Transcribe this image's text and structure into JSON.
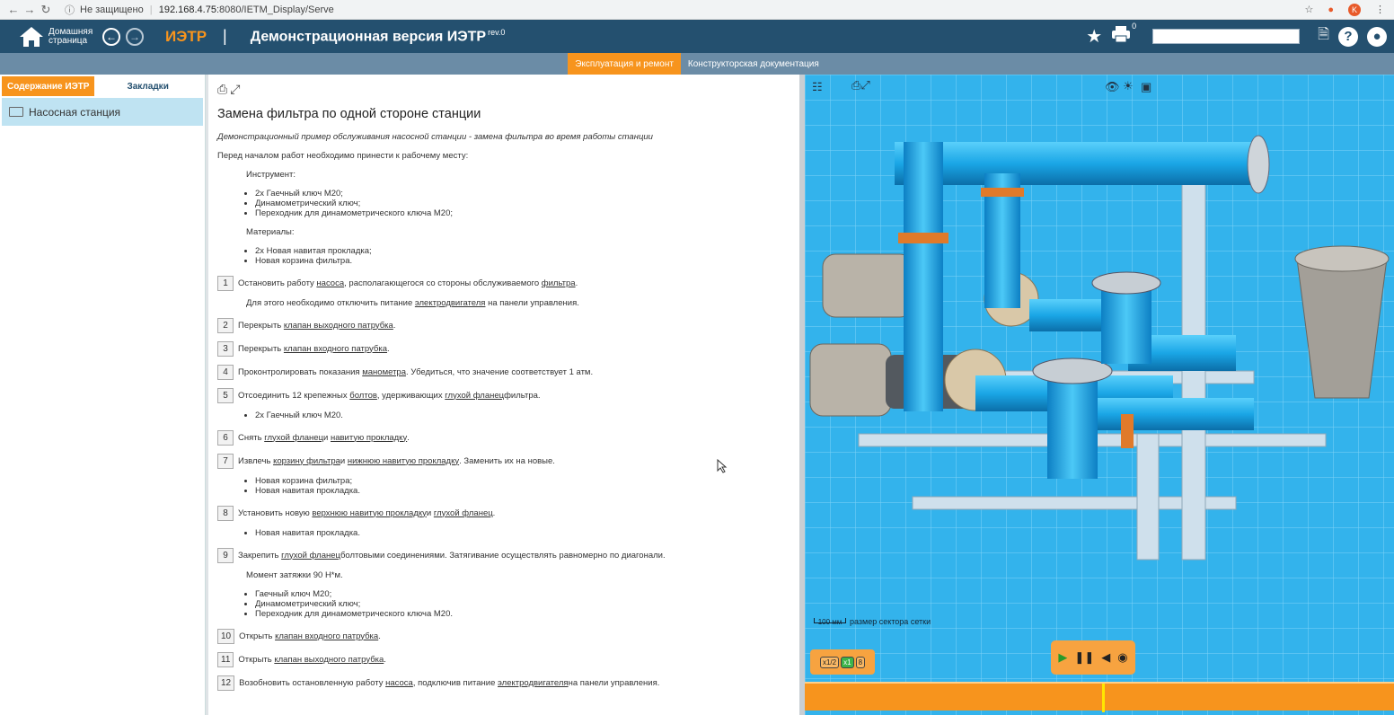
{
  "browser": {
    "security": "Не защищено",
    "host": "192.168.4.75",
    "path": ":8080/IETM_Display/Serve"
  },
  "appbar": {
    "home_label": "Домашняя страница",
    "brand": "ИЭТР",
    "title": "Демонстрационная версия ИЭТР",
    "rev": "rev.0",
    "print_badge": "0"
  },
  "subtabs": [
    "Эксплуатация и ремонт",
    "Конструкторская документация"
  ],
  "sidebar": {
    "tabs": [
      "Содержание ИЭТР",
      "Закладки"
    ],
    "tree": [
      "Насосная станция"
    ]
  },
  "doc": {
    "title": "Замена фильтра по одной стороне станции",
    "intro": "Демонстрационный пример обслуживания насосной станции - замена фильтра во время работы станции",
    "before": "Перед началом работ необходимо принести к рабочему месту:",
    "tools_hdr": "Инструмент:",
    "tools": [
      "2х Гаечный ключ М20;",
      "Динамометрический ключ;",
      "Переходник для динамометрического ключа М20;"
    ],
    "mat_hdr": "Материалы:",
    "materials": [
      "2х Новая навитая прокладка;",
      "Новая корзина фильтра."
    ],
    "s1": {
      "n": "1",
      "a": "Остановить работу ",
      "l1": "насоса",
      "b": ", располагающегося со стороны обслуживаемого ",
      "l2": "фильтра",
      "c": "."
    },
    "s1note": {
      "a": "Для этого необходимо отключить питание ",
      "l": "электродвигателя",
      "b": " на панели управления."
    },
    "s2": {
      "n": "2",
      "a": "Перекрыть ",
      "l": "клапан выходного патрубка",
      "b": "."
    },
    "s3": {
      "n": "3",
      "a": "Перекрыть ",
      "l": "клапан входного патрубка",
      "b": "."
    },
    "s4": {
      "n": "4",
      "a": "Проконтролировать показания ",
      "l": "манометра",
      "b": ". Убедиться, что значение соответствует 1 атм."
    },
    "s5": {
      "n": "5",
      "a": "Отсоединить 12 крепежных ",
      "l1": "болтов",
      "b": ", удерживающих ",
      "l2": "глухой фланец",
      "c": " фильтра."
    },
    "s5list": [
      "2х Гаечный ключ М20."
    ],
    "s6": {
      "n": "6",
      "a": "Снять ",
      "l1": "глухой фланец",
      "b": " и ",
      "l2": "навитую прокладку",
      "c": "."
    },
    "s7": {
      "n": "7",
      "a": "Извлечь ",
      "l1": "корзину фильтра",
      "b": " и ",
      "l2": "нижнюю навитую прокладку",
      "c": ". Заменить их на новые."
    },
    "s7list": [
      "Новая корзина фильтра;",
      "Новая навитая прокладка."
    ],
    "s8": {
      "n": "8",
      "a": "Установить новую ",
      "l1": "верхнюю навитую прокладку",
      "b": " и ",
      "l2": "глухой фланец",
      "c": "."
    },
    "s8list": [
      "Новая навитая прокладка."
    ],
    "s9": {
      "n": "9",
      "a": "Закрепить ",
      "l": "глухой фланец",
      "b": " болтовыми соединениями. Затягивание осуществлять равномерно по диагонали."
    },
    "s9note": "Момент затяжки 90 Н*м.",
    "s9list": [
      "Гаечный ключ М20;",
      "Динамометрический ключ;",
      "Переходник для динамометрического ключа М20."
    ],
    "s10": {
      "n": "10",
      "a": "Открыть ",
      "l": "клапан входного патрубка",
      "b": "."
    },
    "s11": {
      "n": "11",
      "a": "Открыть ",
      "l": "клапан выходного патрубка",
      "b": "."
    },
    "s12": {
      "n": "12",
      "a": "Возобновить остановленную работу ",
      "l1": "насоса",
      "b": ", подключив питание ",
      "l2": "электродвигателя",
      "c": " на панели управления."
    }
  },
  "viewer": {
    "scale_value": "100 мм",
    "scale_label": "размер сектора сетки",
    "speeds": [
      "x1/2",
      "x1",
      "8"
    ],
    "timeline_progress": 0.505
  },
  "colors": {
    "header": "#24506f",
    "accent": "#f7941d",
    "pipe": "#1aa6e6"
  }
}
